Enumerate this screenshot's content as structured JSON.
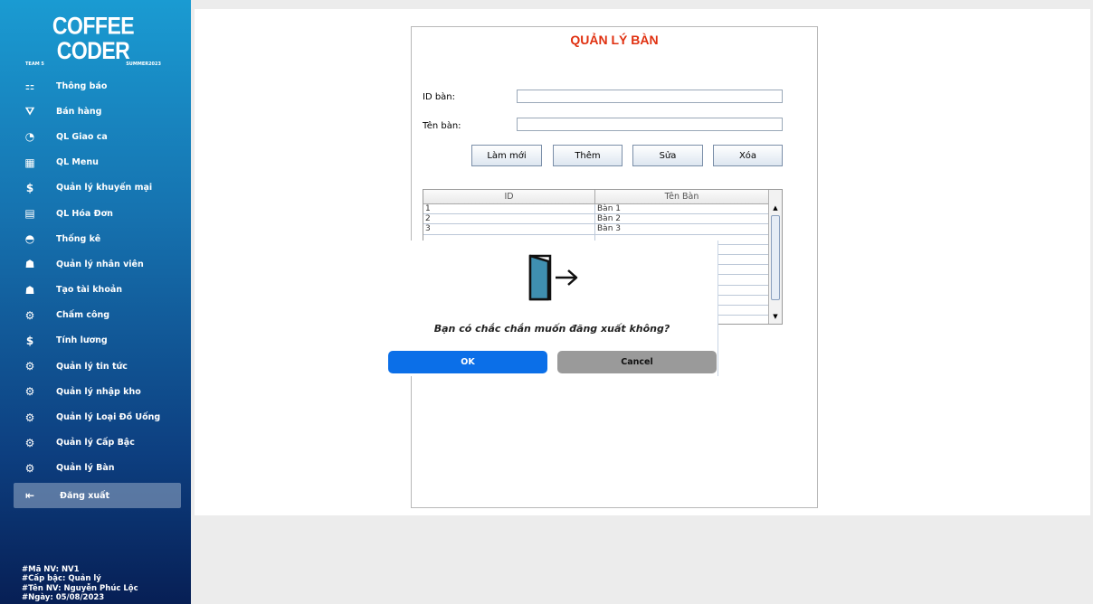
{
  "sidebar": {
    "logo": {
      "title": "COFFEE CODER",
      "left": "TEAM 5",
      "right": "SUMMER2023"
    },
    "items": [
      {
        "label": "Thông báo",
        "icon": "notification-icon",
        "glyph": "⚏"
      },
      {
        "label": "Bán hàng",
        "icon": "sell-icon",
        "glyph": "⛛"
      },
      {
        "label": "QL Giao ca",
        "icon": "shift-icon",
        "glyph": "◔"
      },
      {
        "label": "QL Menu",
        "icon": "grid-icon",
        "glyph": "▦"
      },
      {
        "label": "Quản lý khuyến mại",
        "icon": "dollar-icon",
        "glyph": "$"
      },
      {
        "label": "QL Hóa Đơn",
        "icon": "invoice-icon",
        "glyph": "▤"
      },
      {
        "label": "Thống kê",
        "icon": "dashboard-icon",
        "glyph": "◓"
      },
      {
        "label": "Quản lý nhân viên",
        "icon": "person-icon",
        "glyph": "☗"
      },
      {
        "label": "Tạo tài khoản",
        "icon": "person-icon",
        "glyph": "☗"
      },
      {
        "label": "Chấm công",
        "icon": "gear-icon",
        "glyph": "⚙"
      },
      {
        "label": "Tính lương",
        "icon": "dollar-icon",
        "glyph": "$"
      },
      {
        "label": "Quản lý tin tức",
        "icon": "gear-icon",
        "glyph": "⚙"
      },
      {
        "label": "Quản lý nhập kho",
        "icon": "gear-icon",
        "glyph": "⚙"
      },
      {
        "label": "Quản lý Loại Đồ Uống",
        "icon": "gear-icon",
        "glyph": "⚙"
      },
      {
        "label": "Quản lý Cấp Bậc",
        "icon": "gear-icon",
        "glyph": "⚙"
      },
      {
        "label": "Quản lý Bàn",
        "icon": "gear-icon",
        "glyph": "⚙"
      }
    ],
    "logout": {
      "label": "Đăng xuất",
      "icon": "logout-icon",
      "glyph": "⇤"
    },
    "footer": [
      "#Mã NV: NV1",
      "#Cấp bậc: Quản lý",
      "#Tên NV: Nguyễn Phúc Lộc",
      "#Ngày: 05/08/2023"
    ]
  },
  "form": {
    "title": "QUẢN LÝ BÀN",
    "id_label": "ID bàn:",
    "id_value": "",
    "name_label": "Tên bàn:",
    "name_value": "",
    "buttons": {
      "refresh": "Làm mới",
      "add": "Thêm",
      "edit": "Sửa",
      "delete": "Xóa"
    }
  },
  "table": {
    "headers": [
      "ID",
      "Tên Bàn"
    ],
    "rows": [
      [
        "1",
        "Bàn 1"
      ],
      [
        "2",
        "Bàn 2"
      ],
      [
        "3",
        "Bàn 3"
      ]
    ]
  },
  "dialog": {
    "message": "Bạn có chắc chắn muốn đăng xuất không?",
    "ok": "OK",
    "cancel": "Cancel",
    "icon": "logout-door-icon"
  },
  "colors": {
    "accent": "#0b6fe8",
    "title_red": "#e03010",
    "cancel_gray": "#9a9a9a",
    "door_teal": "#3f8fb0"
  }
}
